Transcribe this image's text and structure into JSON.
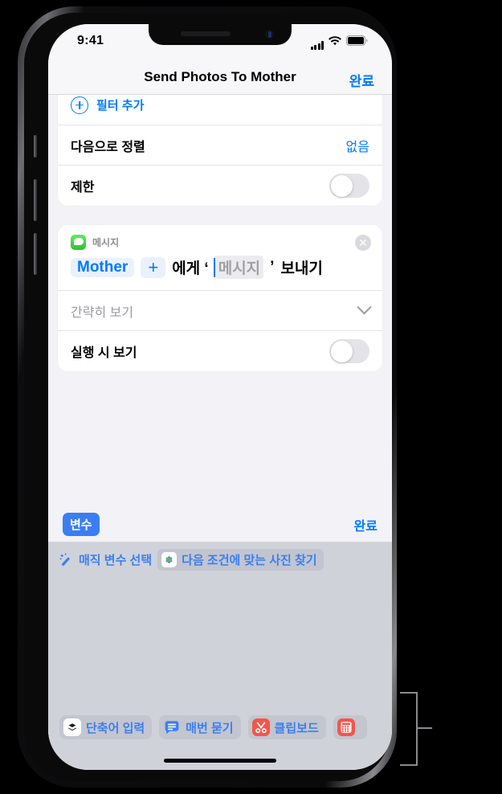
{
  "status_bar": {
    "time": "9:41",
    "signal_icon": "cellular-bars-icon",
    "wifi_icon": "wifi-icon",
    "battery_icon": "battery-full-icon"
  },
  "nav": {
    "title": "Send Photos To Mother",
    "done_label": "완료"
  },
  "filters_card": {
    "add_filter_label": "필터 추가",
    "sort_label": "다음으로 정렬",
    "sort_value": "없음",
    "limit_label": "제한",
    "limit_enabled": "false"
  },
  "message_card": {
    "app_name": "메시지",
    "close_label": "✕",
    "recipient_token": "Mother",
    "add_recipient_label": "+",
    "text_after_recipient": "에게 ‘",
    "message_placeholder": "메시지",
    "text_quote_close": "’",
    "text_send": "보내기",
    "show_less_label": "간략히 보기",
    "show_when_run_label": "실행 시 보기",
    "show_when_run_enabled": "false"
  },
  "variable_bar": {
    "variables_button_label": "변수",
    "done_label": "완료"
  },
  "magic_row": {
    "select_magic_variable_label": "매직 변수 선택",
    "suggestion_label": "다음 조건에 맞는 사진 찾기",
    "suggestion_icon": "photos-app-icon"
  },
  "bottom_chips": [
    {
      "label": "단축어 입력",
      "icon": "shortcut-input-icon"
    },
    {
      "label": "매번 묻기",
      "icon": "ask-each-time-icon"
    },
    {
      "label": "클립보드",
      "icon": "clipboard-scissors-icon"
    },
    {
      "label": "",
      "icon": "calculator-icon"
    }
  ],
  "colors": {
    "accent_blue": "#007aff",
    "variable_blue": "#3b7ef3",
    "messages_green": "#34c759",
    "clipboard_red": "#f2564b",
    "screen_bg": "#f2f2f7",
    "keyboard_bg": "#d0d2d9"
  }
}
